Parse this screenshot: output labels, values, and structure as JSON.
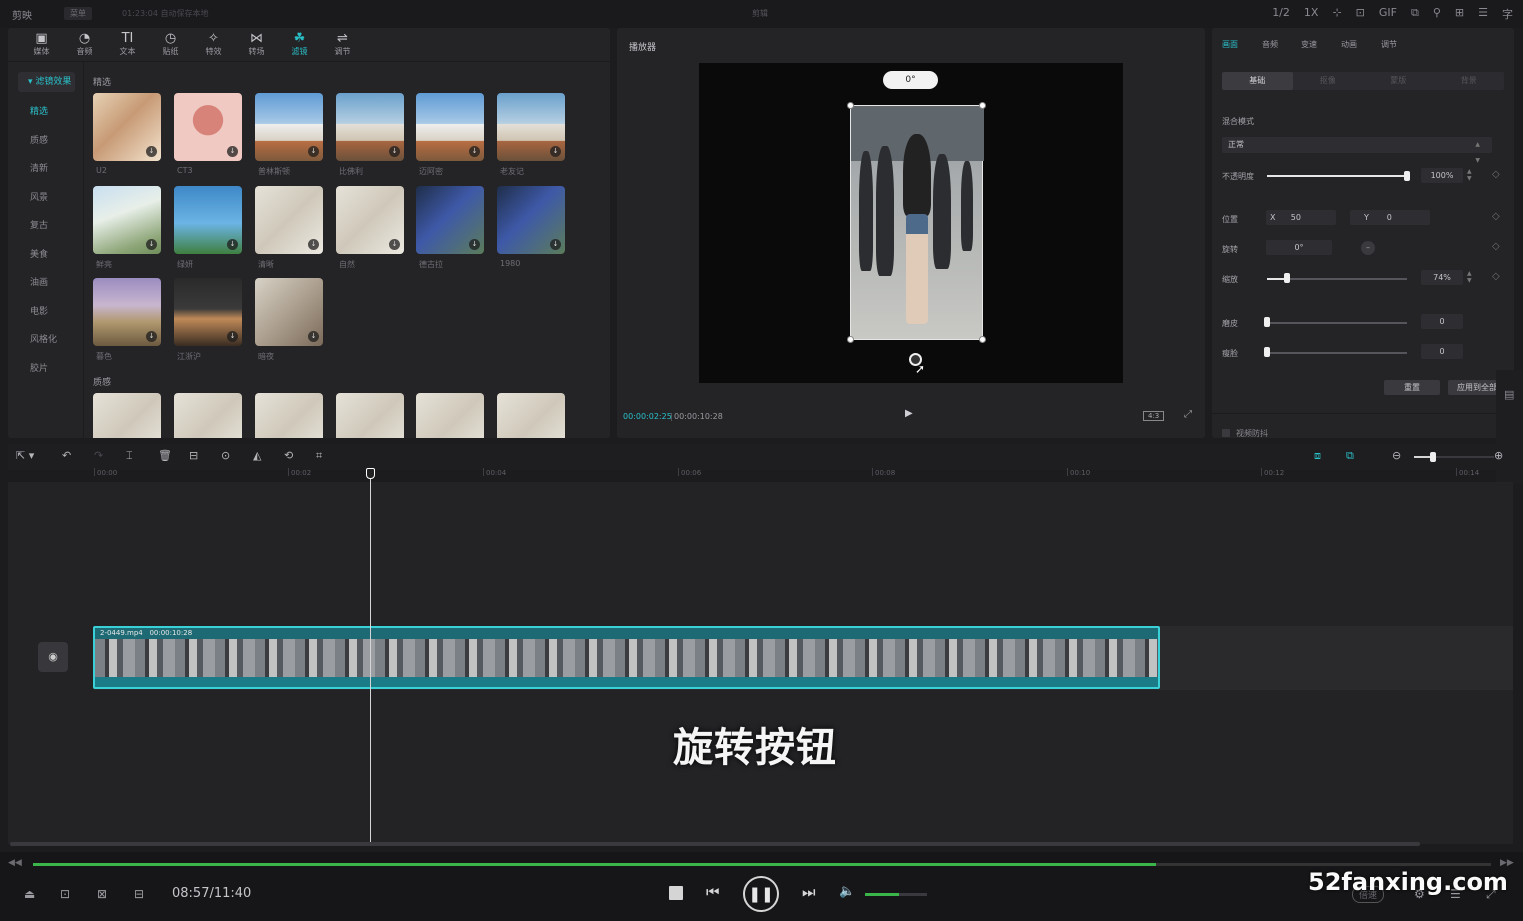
{
  "titlebar": {
    "logo": "剪映",
    "menu": "菜单",
    "status": "01:23:04 自动保存本地",
    "center": "剪辑",
    "icons": [
      "1/2",
      "1X",
      "crop-icon",
      "ratio-icon",
      "GIF",
      "layers-icon",
      "play-mode-icon",
      "grid-icon",
      "list-icon",
      "text-icon"
    ]
  },
  "toolbar": {
    "items": [
      {
        "label": "媒体",
        "icon": "▣"
      },
      {
        "label": "音频",
        "icon": "◔"
      },
      {
        "label": "文本",
        "icon": "TI"
      },
      {
        "label": "贴纸",
        "icon": "◷"
      },
      {
        "label": "特效",
        "icon": "✧"
      },
      {
        "label": "转场",
        "icon": "⋈"
      },
      {
        "label": "滤镜",
        "icon": "☘"
      },
      {
        "label": "调节",
        "icon": "⇌"
      }
    ]
  },
  "categories": {
    "head": "滤镜效果",
    "items": [
      "精选",
      "质感",
      "清新",
      "风景",
      "复古",
      "美食",
      "油画",
      "电影",
      "风格化",
      "胶片"
    ]
  },
  "filters": {
    "section1": "精选",
    "section2": "质感",
    "items": [
      {
        "label": "U2"
      },
      {
        "label": "CT3"
      },
      {
        "label": "普林斯顿"
      },
      {
        "label": "比佛利"
      },
      {
        "label": "迈阿密"
      },
      {
        "label": "老友记"
      },
      {
        "label": "鲜亮"
      },
      {
        "label": "绿妍"
      },
      {
        "label": "清晰"
      },
      {
        "label": "自然"
      },
      {
        "label": "德古拉"
      },
      {
        "label": "1980"
      },
      {
        "label": "暮色"
      },
      {
        "label": "江浙沪"
      },
      {
        "label": "暗夜"
      }
    ]
  },
  "player": {
    "title": "播放器",
    "rotation": "0°",
    "time_current": "00:00:02:25",
    "time_total": "00:00:10:28",
    "ratio": "4:3"
  },
  "properties": {
    "tabs": [
      "画面",
      "音频",
      "变速",
      "动画",
      "调节"
    ],
    "subtabs": [
      "基础",
      "抠像",
      "蒙版",
      "背景"
    ],
    "blend_label": "混合模式",
    "blend_value": "正常",
    "opacity_label": "不透明度",
    "opacity_value": "100%",
    "opacity": 1.0,
    "position_label": "位置",
    "x_label": "X",
    "x_value": "50",
    "y_label": "Y",
    "y_value": "0",
    "rotate_label": "旋转",
    "rotate_value": "0°",
    "scale_label": "缩放",
    "scale_value": "74%",
    "scale": 0.14,
    "smooth_label": "磨皮",
    "smooth_value": "0",
    "thin_label": "瘦脸",
    "thin_value": "0",
    "reset": "重置",
    "apply_all": "应用到全部",
    "video_anti_shake": "视频防抖"
  },
  "timeline": {
    "ticks": [
      "00:00",
      "00:02",
      "00:04",
      "00:06",
      "00:08",
      "00:10",
      "00:12",
      "00:14"
    ],
    "clip_name": "2-0449.mp4",
    "clip_duration": "00:00:10:28",
    "caption": "旋转按钮"
  },
  "bottom": {
    "time": "08:57/11:40",
    "progress": 0.77,
    "volume": 0.55,
    "speed": "倍速"
  },
  "watermark": "52fanxing.com"
}
